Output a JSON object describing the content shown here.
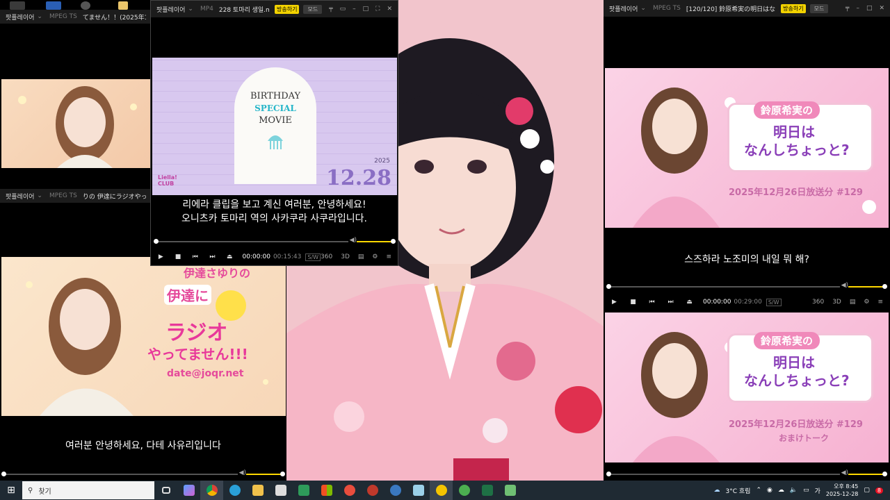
{
  "players": {
    "top_left": {
      "app": "팟플레이어",
      "format": "MPEG TS",
      "title": "てません！！(2025年12..."
    },
    "left_middle": {
      "app": "팟플레이어",
      "format": "MPEG TS",
      "title": "りの 伊達にラジオやって",
      "subtitle": "여러분 안녕하세요, 다테 사유리입니다",
      "thumb_banner": {
        "name_jp": "伊達さゆりの",
        "title1": "伊達に",
        "title2": "ラジオ",
        "title3": "やってません!!!",
        "email": "date@joqr.net"
      }
    },
    "center": {
      "app": "팟플레이어",
      "format": "MP4",
      "title": "228 토마리 생일.mp4",
      "broadcast_label": "방송하기",
      "mode_label": "모드",
      "subtitle_line1": "리에라 클립을 보고 계신 여러분, 안녕하세요!",
      "subtitle_line2": "오니츠카 토마리 역의 사카쿠라 사쿠라입니다.",
      "time_current": "00:00:00",
      "time_total": "00:15:43",
      "tag1": "S/W",
      "tag2": "360",
      "tag3": "3D",
      "card": {
        "line1": "BIRTHDAY",
        "line2": "SPECIAL",
        "line3": "MOVIE",
        "year": "2025",
        "date": "12.28",
        "logo": "Liella! CLUB"
      }
    },
    "right": {
      "app": "팟플레이어",
      "format": "MPEG TS",
      "title": "[120/120] 鈴原希実の明日はな",
      "broadcast_label": "방송하기",
      "mode_label": "모드",
      "subtitle": "스즈하라 노조미의 내일 뭐 해?",
      "time_current": "00:00:00",
      "time_total": "00:29:00",
      "tag1": "S/W",
      "tag2": "360",
      "tag3": "3D",
      "banner": {
        "name": "鈴原希実の",
        "line1": "明日は",
        "line2": "なんしちょっと?",
        "date": "2025年12月26日放送分 #129"
      },
      "banner2_extra": "おまけトーク"
    }
  },
  "taskbar": {
    "search_placeholder": "찾기",
    "weather": "3°C 흐림",
    "clock_time": "오후 8:45",
    "clock_date": "2025-12-28",
    "notification_count": "8"
  },
  "colors": {
    "accent_yellow": "#ffd800",
    "pink_banner": "#f7b6d2",
    "purple_card": "#d7c6ee",
    "banner_text": "#8a3fb8"
  }
}
